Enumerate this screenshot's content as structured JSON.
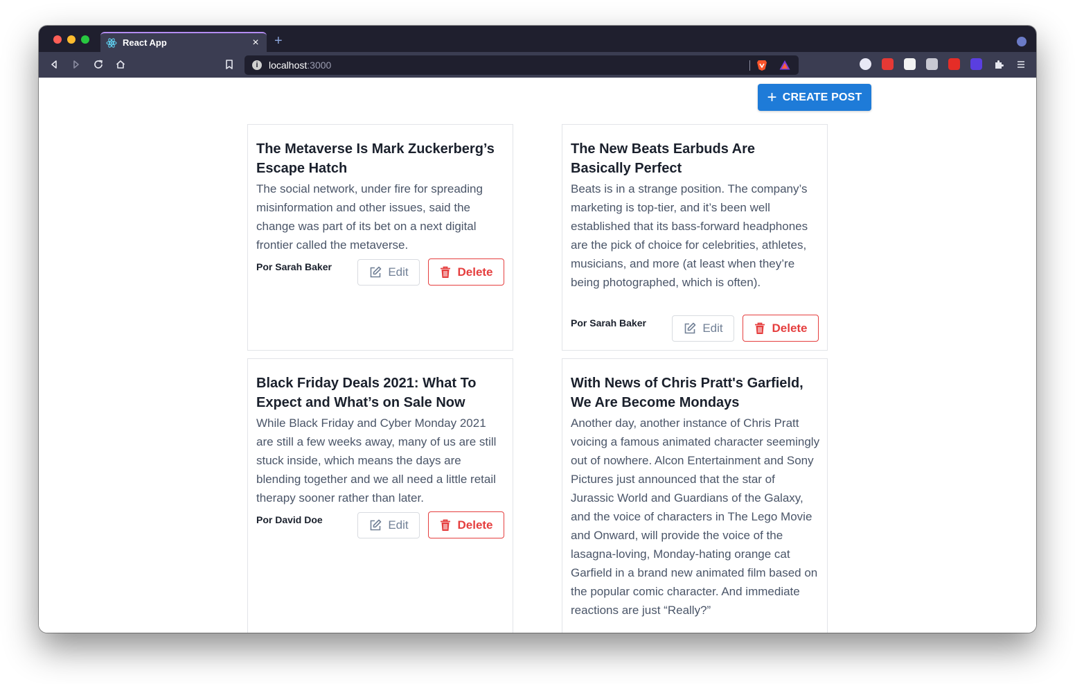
{
  "browser": {
    "tab_title": "React App",
    "tab_close": "×",
    "new_tab": "+",
    "url_host": "localhost",
    "url_port": ":3000"
  },
  "actions": {
    "create_post_label": "CREATE POST"
  },
  "posts": [
    {
      "title": "The Metaverse Is Mark Zuckerberg’s Escape Hatch",
      "body": "The social network, under fire for spreading misinformation and other issues, said the change was part of its bet on a next digital frontier called the metaverse.",
      "author": "Por Sarah Baker",
      "edit_label": "Edit",
      "delete_label": "Delete"
    },
    {
      "title": "The New Beats Earbuds Are Basically Perfect",
      "body": "Beats is in a strange position. The company’s marketing is top-tier, and it’s been well established that its bass-forward headphones are the pick of choice for celebrities, athletes, musicians, and more (at least when they’re being photographed, which is often).",
      "author": "Por Sarah Baker",
      "edit_label": "Edit",
      "delete_label": "Delete"
    },
    {
      "title": "Black Friday Deals 2021: What To Expect and What’s on Sale Now",
      "body": "While Black Friday and Cyber Monday 2021 are still a few weeks away, many of us are still stuck inside, which means the days are blending together and we all need a little retail therapy sooner rather than later.",
      "author": "Por David Doe",
      "edit_label": "Edit",
      "delete_label": "Delete"
    },
    {
      "title": "With News of Chris Pratt's Garfield, We Are Become Mondays",
      "body": "Another day, another instance of Chris Pratt voicing a famous animated character seemingly out of nowhere. Alcon Entertainment and Sony Pictures just announced that the star of Jurassic World and Guardians of the Galaxy, and the voice of characters in The Lego Movie and Onward, will provide the voice of the lasagna-loving, Monday-hating orange cat Garfield in a brand new animated film based on the popular comic character. And immediate reactions are just “Really?”"
    }
  ]
}
